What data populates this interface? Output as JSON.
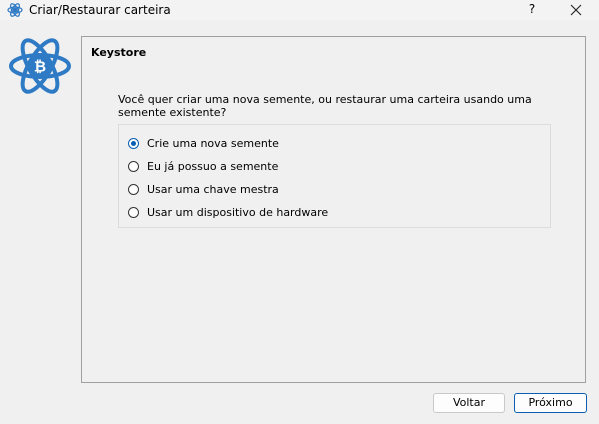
{
  "window": {
    "title": "Criar/Restaurar carteira",
    "help_label": "?",
    "app_icon": "electrum-bitcoin-icon",
    "close_icon": "close-icon"
  },
  "panel": {
    "title": "Keystore",
    "question": "Você quer criar uma nova semente, ou restaurar uma carteira usando uma semente existente?",
    "options": [
      {
        "label": "Crie uma nova semente",
        "checked": true
      },
      {
        "label": "Eu já possuo a semente",
        "checked": false
      },
      {
        "label": "Usar uma chave mestra",
        "checked": false
      },
      {
        "label": "Usar um dispositivo de hardware",
        "checked": false
      }
    ]
  },
  "buttons": {
    "back_label": "Voltar",
    "next_label": "Próximo"
  },
  "colors": {
    "accent": "#0a5fb4",
    "logo": "#2f7ac4"
  }
}
